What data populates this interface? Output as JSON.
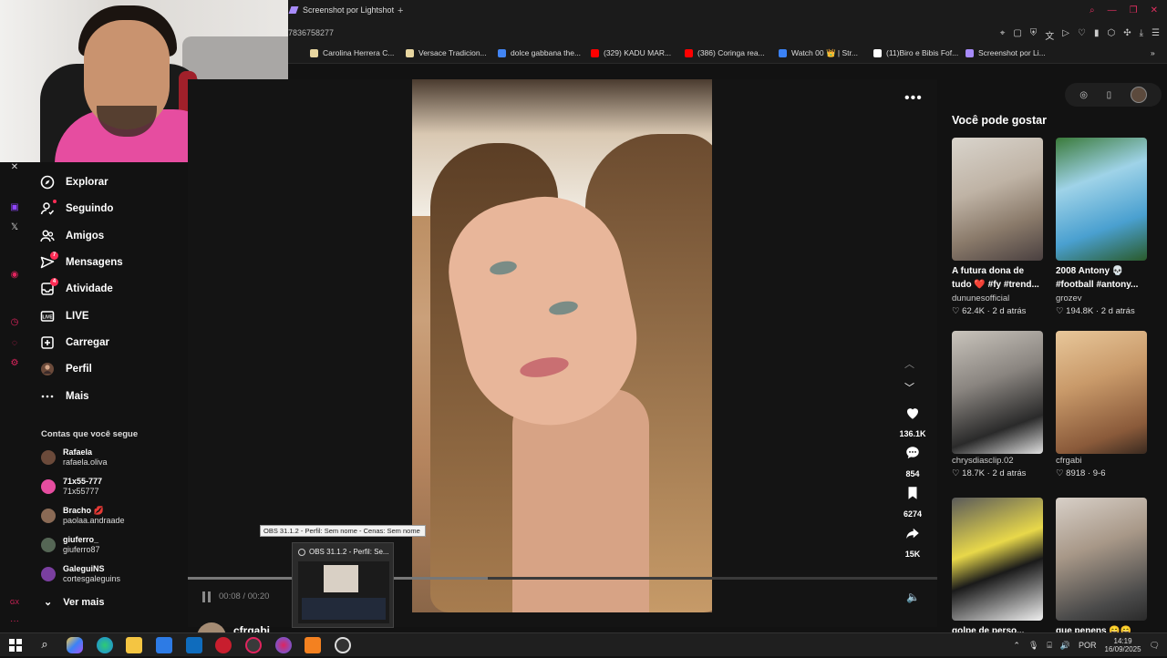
{
  "browser": {
    "tab_title": "Screenshot por Lightshot",
    "new_tab": "+",
    "url_fragment": "7836758277",
    "bookmarks": [
      {
        "label": "Carolina Herrera C...",
        "color": "#e8d6a0"
      },
      {
        "label": "Versace Tradicion...",
        "color": "#e8d6a0"
      },
      {
        "label": "dolce gabbana the...",
        "color": "#4285f4"
      },
      {
        "label": "(329) KADU MAR...",
        "color": "#ff0000"
      },
      {
        "label": "(386) Coringa rea...",
        "color": "#ff0000"
      },
      {
        "label": "Watch 00 👑 | Str...",
        "color": "#3b82f6"
      },
      {
        "label": "(11)Biro e Bibis Fof...",
        "color": "#ffffff"
      },
      {
        "label": "Screenshot por Li...",
        "color": "#a78bfa"
      }
    ],
    "more_bookmarks": "»"
  },
  "sidebar": {
    "nav": [
      {
        "label": "Explorar",
        "icon": "compass-icon"
      },
      {
        "label": "Seguindo",
        "icon": "following-icon",
        "dot": true
      },
      {
        "label": "Amigos",
        "icon": "friends-icon"
      },
      {
        "label": "Mensagens",
        "icon": "messages-icon",
        "badge": "7"
      },
      {
        "label": "Atividade",
        "icon": "activity-icon",
        "badge": "4"
      },
      {
        "label": "LIVE",
        "icon": "live-icon"
      },
      {
        "label": "Carregar",
        "icon": "upload-icon"
      },
      {
        "label": "Perfil",
        "icon": "profile-icon"
      },
      {
        "label": "Mais",
        "icon": "more-icon"
      }
    ],
    "following_title": "Contas que você segue",
    "accounts": [
      {
        "name": "Rafaela",
        "handle": "rafaela.oliva",
        "color": "#6b4a3a"
      },
      {
        "name": "71x55-777",
        "handle": "71x55777",
        "color": "#e64da0"
      },
      {
        "name": "Bracho 💋",
        "handle": "paolaa.andraade",
        "color": "#8a6a55"
      },
      {
        "name": "giuferro_",
        "handle": "giuferro87",
        "color": "#556655"
      },
      {
        "name": "GaleguiNS",
        "handle": "cortesgaleguins",
        "color": "#7a3fa0"
      }
    ],
    "see_more": "Ver mais"
  },
  "player": {
    "likes": "136.1K",
    "comments": "854",
    "saves": "6274",
    "shares": "15K",
    "time": "00:08 / 00:20",
    "progress": 0.4,
    "author": "cfrgabi"
  },
  "recommendations": {
    "title": "Você pode gostar",
    "items": [
      {
        "title": "A futura dona de tudo ❤️ #fy #trend...",
        "user": "dununesofficial",
        "likes": "62.4K",
        "date": "2 d atrás"
      },
      {
        "title": "2008 Antony 💀 #football #antony...",
        "user": "grozev",
        "likes": "194.8K",
        "date": "2 d atrás"
      },
      {
        "title": "",
        "user": "chrysdiasclip.02",
        "likes": "18.7K",
        "date": "2 d atrás"
      },
      {
        "title": "",
        "user": "cfrgabi",
        "likes": "8918",
        "date": "9-6"
      },
      {
        "title": "golpe de perso...",
        "user": "",
        "likes": "",
        "date": ""
      },
      {
        "title": "que penens 😄😄",
        "user": "",
        "likes": "",
        "date": ""
      }
    ]
  },
  "obs": {
    "tooltip": "OBS 31.1.2 - Perfil: Sem nome - Cenas: Sem nome",
    "preview_title": "OBS 31.1.2 - Perfil: Se..."
  },
  "taskbar": {
    "lang": "POR",
    "time": "14:19",
    "date": "16/09/2025"
  }
}
